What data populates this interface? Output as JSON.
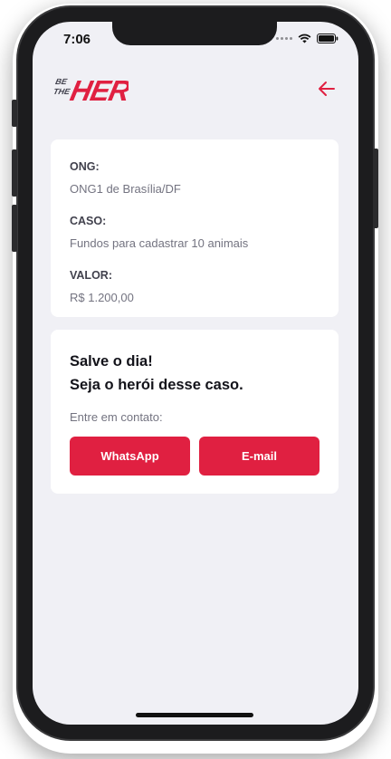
{
  "status_bar": {
    "time": "7:06"
  },
  "header": {
    "logo_text_small_top": "BE",
    "logo_text_small_bottom": "THE",
    "logo_text_big": "HERO",
    "back_icon": "arrow-left-icon"
  },
  "incident": {
    "ong_label": "ONG:",
    "ong_value": "ONG1 de Brasília/DF",
    "case_label": "CASO:",
    "case_value": "Fundos para cadastrar 10 animais",
    "value_label": "VALOR:",
    "value_value": "R$ 1.200,00"
  },
  "contact": {
    "title_line1": "Salve o dia!",
    "title_line2": "Seja o herói desse caso.",
    "prompt": "Entre em contato:",
    "whatsapp_label": "WhatsApp",
    "email_label": "E-mail"
  },
  "colors": {
    "brand": "#e02041",
    "background": "#f0f0f5",
    "card": "#ffffff"
  }
}
